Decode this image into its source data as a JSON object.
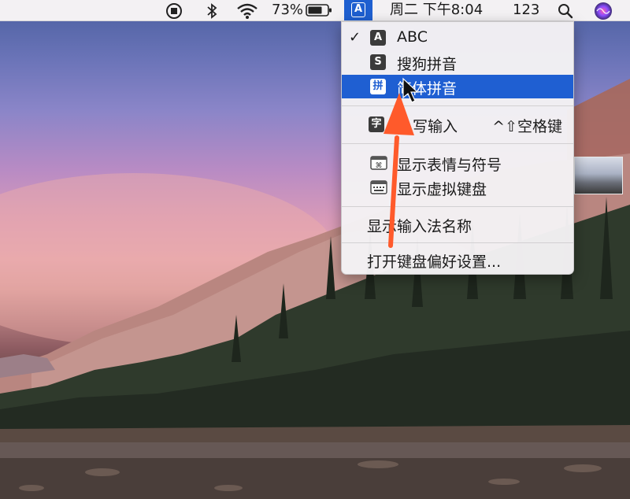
{
  "menubar": {
    "battery_percent": "73%",
    "input_icon_letter": "A",
    "day_time": "周二 下午8:04",
    "numbers": "123"
  },
  "menu": {
    "items": [
      {
        "label": "ABC",
        "icon": "letter-a-icon",
        "icon_glyph": "A",
        "checked": true,
        "check": "✓"
      },
      {
        "label": "搜狗拼音",
        "icon": "sogou-icon",
        "icon_glyph": "S"
      },
      {
        "label": "简体拼音",
        "icon": "pinyin-icon",
        "icon_glyph": "拼",
        "selected": true
      },
      {
        "label": "写输入",
        "icon": "handwriting-icon",
        "icon_glyph": "字",
        "shortcut": "^⇧空格键"
      },
      {
        "label": "显示表情与符号",
        "icon": "emoji-symbols-icon"
      },
      {
        "label": "显示虚拟键盘",
        "icon": "keyboard-icon"
      },
      {
        "label": "显示输入法名称"
      },
      {
        "label": "打开键盘偏好设置..."
      }
    ]
  },
  "colors": {
    "menu_highlight": "#1f5fd2",
    "arrow": "#ff5a2b"
  }
}
